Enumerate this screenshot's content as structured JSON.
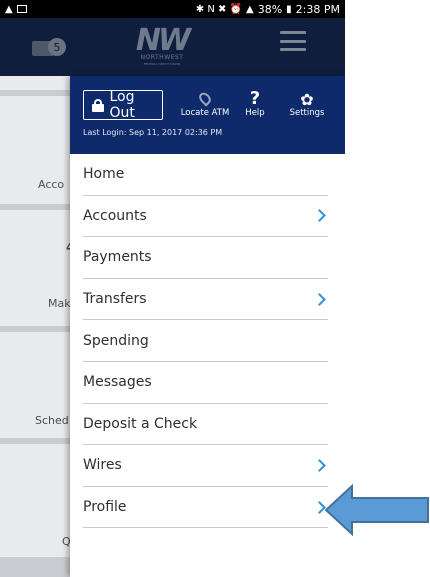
{
  "status_bar": {
    "battery": "38%",
    "time": "2:38 PM",
    "signal_glyphs": "✱ N ✖ ⏰"
  },
  "header": {
    "message_count": "5",
    "logo_mark": "NW",
    "logo_name": "NORTHWEST",
    "logo_sub": "FEDERAL CREDIT UNION"
  },
  "background": {
    "labels": [
      "Acco",
      "Mak",
      "Sched",
      "Q"
    ]
  },
  "drawer": {
    "logout_label": "Log Out",
    "last_login": "Last Login: Sep 11, 2017 02:36 PM",
    "atm_label": "Locate ATM",
    "help_label": "Help",
    "settings_label": "Settings"
  },
  "menu": {
    "items": [
      {
        "label": "Home",
        "chevron": false
      },
      {
        "label": "Accounts",
        "chevron": true
      },
      {
        "label": "Payments",
        "chevron": false
      },
      {
        "label": "Transfers",
        "chevron": true
      },
      {
        "label": "Spending",
        "chevron": false
      },
      {
        "label": "Messages",
        "chevron": false
      },
      {
        "label": "Deposit a Check",
        "chevron": false
      },
      {
        "label": "Wires",
        "chevron": true
      },
      {
        "label": "Profile",
        "chevron": true
      }
    ]
  },
  "colors": {
    "header_bg": "#0e1e3c",
    "drawer_top_bg": "#0e2a6b",
    "chevron": "#2e8fd8",
    "arrow_fill": "#5b9bd5",
    "arrow_stroke": "#41719c"
  },
  "annotation": {
    "type": "arrow-icon",
    "points_to": "Profile"
  }
}
